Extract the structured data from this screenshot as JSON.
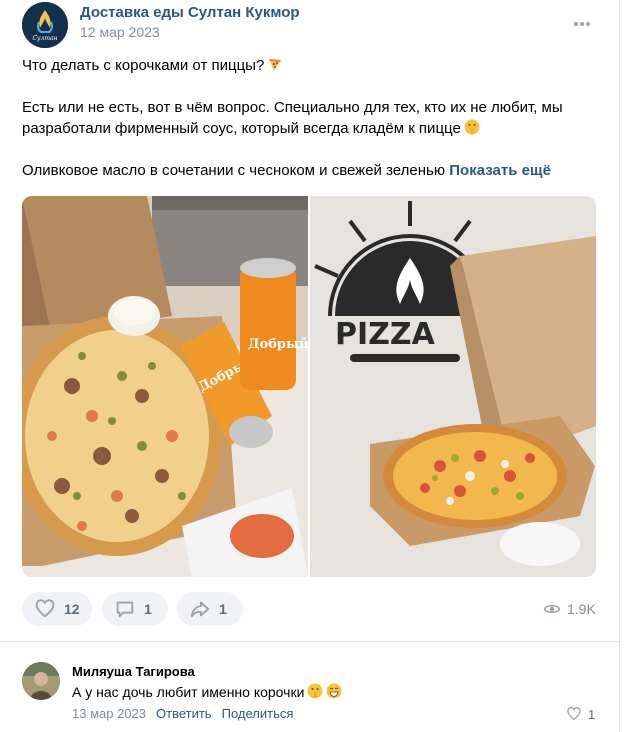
{
  "post": {
    "group_name": "Доставка еды Султан Кукмор",
    "date": "12 мар 2023",
    "logo_text": "Султан",
    "text_line1": "Что делать с корочками от пиццы?",
    "text_line2": "Есть или не есть, вот в чём вопрос. Специально для тех, кто их не любит, мы",
    "text_line3": "разработали фирменный соус, который всегда кладём к пицце",
    "text_line4": "Оливковое масло в сочетании с чесноком и свежей зеленью",
    "show_more": "Показать ещё",
    "photo1_can_label": "Добрый",
    "photo2_sign": "PIZZA"
  },
  "actions": {
    "likes": "12",
    "comments": "1",
    "shares": "1",
    "views": "1.9K"
  },
  "comment": {
    "author": "Миляуша Тагирова",
    "text": "А у нас дочь любит именно корочки",
    "date": "13 мар 2023",
    "reply": "Ответить",
    "share": "Поделиться",
    "likes": "1"
  },
  "icons": {
    "more": "more-dots-icon",
    "like": "heart-icon",
    "comment": "comment-icon",
    "share": "share-arrow-icon",
    "views": "eye-icon",
    "pizza_emoji": "pizza-emoji",
    "shush_emoji": "shushing-face-emoji",
    "grin_emoji": "grinning-face-emoji"
  },
  "colors": {
    "link": "#2a5885",
    "muted": "#818c99",
    "action_bg": "#f0f2f5"
  }
}
